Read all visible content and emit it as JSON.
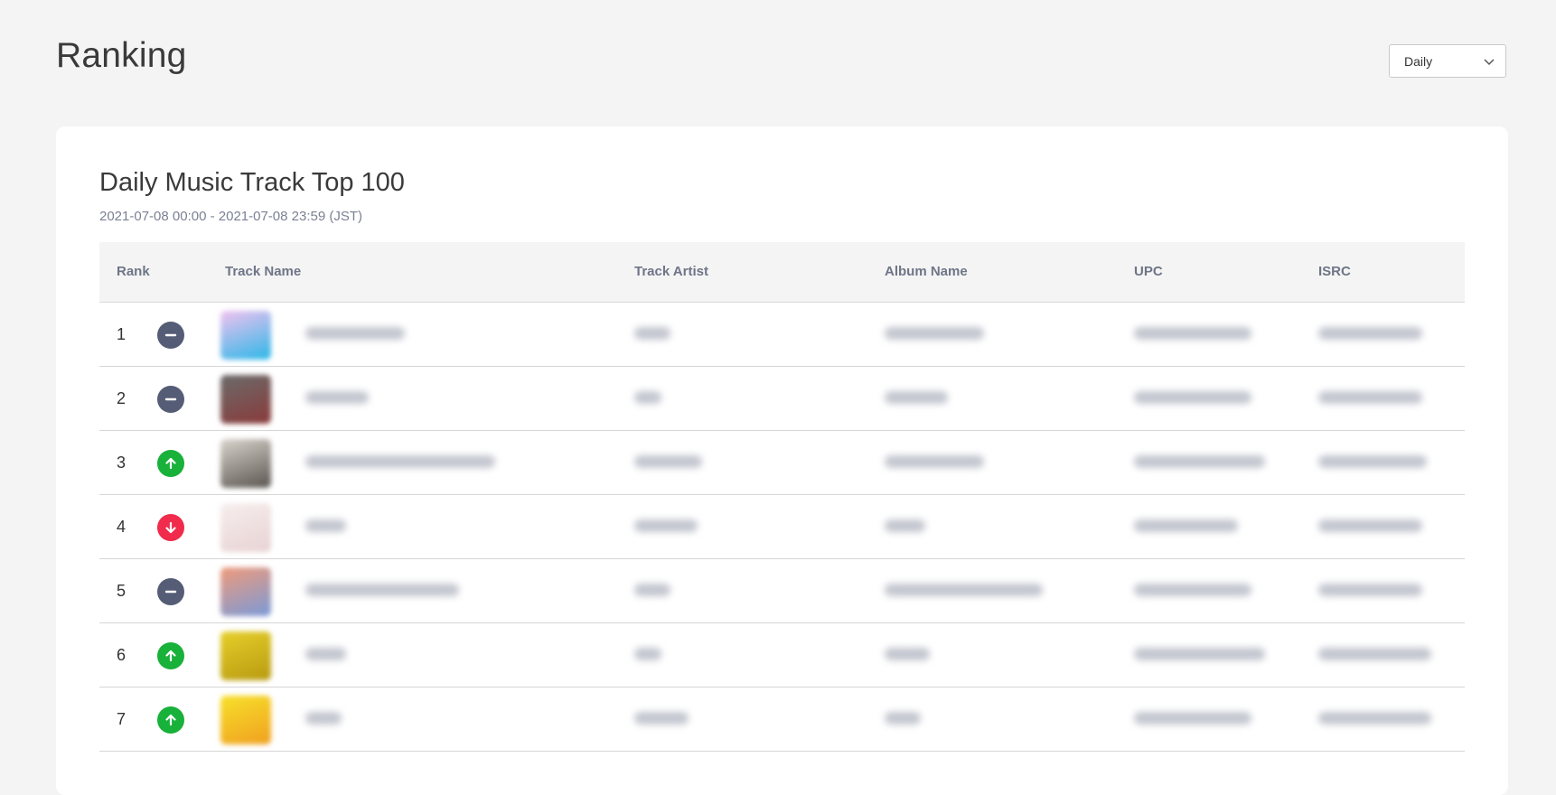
{
  "header": {
    "title": "Ranking",
    "period_select": {
      "value": "Daily"
    }
  },
  "card": {
    "title": "Daily Music Track Top 100",
    "subtitle": "2021-07-08 00:00 - 2021-07-08 23:59 (JST)"
  },
  "table": {
    "columns": [
      "Rank",
      "Track Name",
      "Track Artist",
      "Album Name",
      "UPC",
      "ISRC"
    ],
    "rows": [
      {
        "rank": "1",
        "trend": "same",
        "thumb_color": [
          "#f3c2f0",
          "#2bb7e8"
        ]
      },
      {
        "rank": "2",
        "trend": "same",
        "thumb_color": [
          "#6b6b6b",
          "#8a3a3a"
        ]
      },
      {
        "rank": "3",
        "trend": "up",
        "thumb_color": [
          "#d9d4cc",
          "#5a5550"
        ]
      },
      {
        "rank": "4",
        "trend": "down",
        "thumb_color": [
          "#f6eeee",
          "#e8d2d2"
        ]
      },
      {
        "rank": "5",
        "trend": "same",
        "thumb_color": [
          "#f09a7a",
          "#7a9ad8"
        ]
      },
      {
        "rank": "6",
        "trend": "up",
        "thumb_color": [
          "#e6cf2a",
          "#b89a10"
        ]
      },
      {
        "rank": "7",
        "trend": "up",
        "thumb_color": [
          "#f7e02a",
          "#f0a020"
        ]
      }
    ]
  },
  "colors": {
    "trend_same": "#555c75",
    "trend_up": "#18b13a",
    "trend_down": "#f02b4b"
  },
  "icons": {
    "select_arrow": "chevron-down-icon",
    "same": "minus-icon",
    "up": "arrow-up-icon",
    "down": "arrow-down-icon"
  }
}
